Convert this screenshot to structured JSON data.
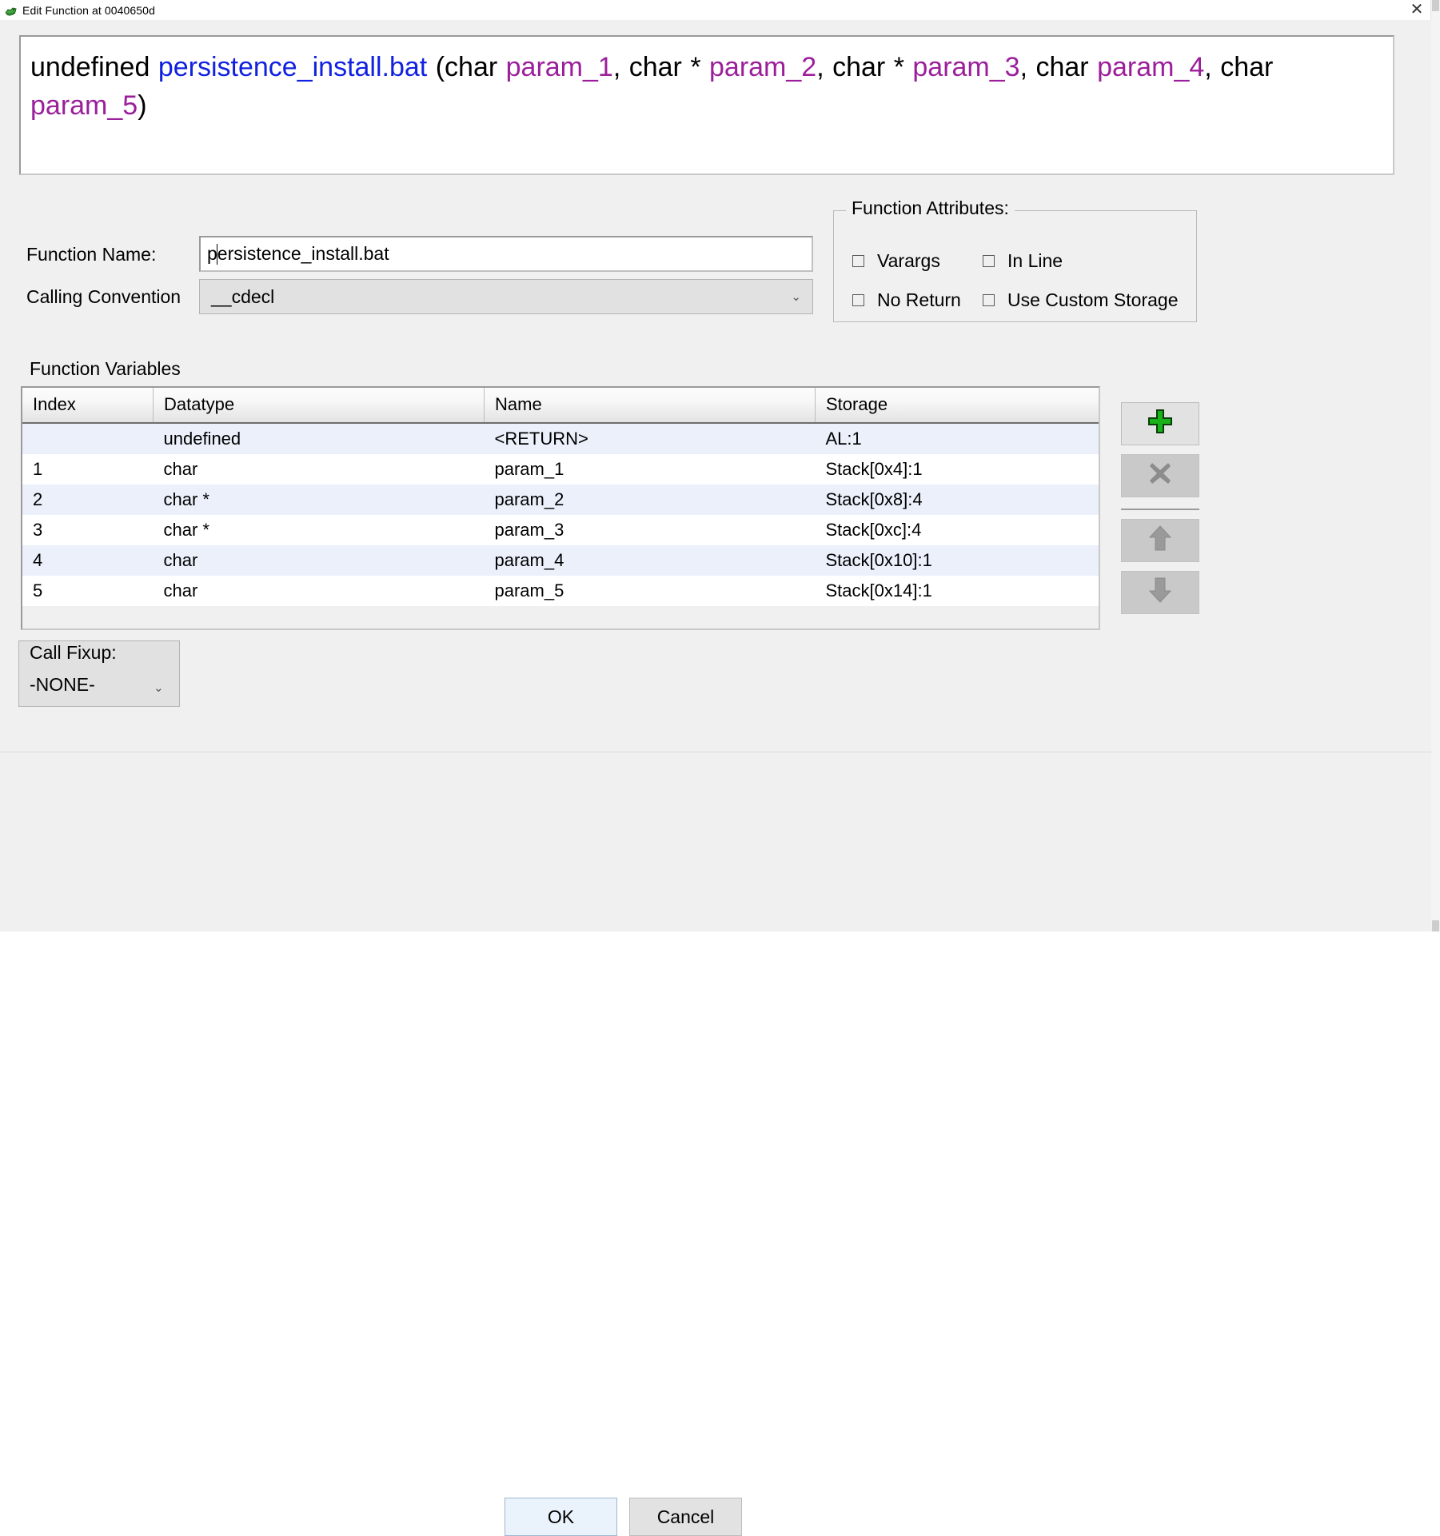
{
  "window": {
    "title": "Edit Function at 0040650d",
    "icon": "ghidra-dragon-icon",
    "close_label": "✕"
  },
  "signature": {
    "return_type": "undefined",
    "function_name": "persistence_install.bat",
    "open_paren": " (",
    "close_paren": ")",
    "parts": [
      {
        "type": "char ",
        "name": "param_1",
        "sep": ", "
      },
      {
        "type": "char * ",
        "name": "param_2",
        "sep": ", "
      },
      {
        "type": "char * ",
        "name": "param_3",
        "sep": ", "
      },
      {
        "type": "char ",
        "name": "param_4",
        "sep": ", "
      },
      {
        "type": "char ",
        "name": "param_5",
        "sep": ""
      }
    ],
    "full_text": "undefined persistence_install.bat (char param_1, char * param_2, char * param_3, char param_4, char param_5)",
    "colors": {
      "function_name": "#1021e0",
      "parameter": "#9b1f9b",
      "text": "#000000"
    }
  },
  "form": {
    "function_name_label": "Function Name:",
    "function_name_value": "persistence_install.bat",
    "function_name_caret_after": "p",
    "calling_convention_label": "Calling Convention",
    "calling_convention_value": "__cdecl",
    "chevron": "⌄"
  },
  "function_attributes": {
    "legend": "Function Attributes:",
    "items": [
      {
        "label": "Varargs",
        "checked": false
      },
      {
        "label": "In Line",
        "checked": false
      },
      {
        "label": "No Return",
        "checked": false
      },
      {
        "label": "Use Custom Storage",
        "checked": false
      }
    ]
  },
  "function_variables": {
    "title": "Function Variables",
    "columns": [
      "Index",
      "Datatype",
      "Name",
      "Storage"
    ],
    "rows": [
      {
        "index": "",
        "datatype": "undefined",
        "name": "<RETURN>",
        "storage": "AL:1",
        "name_muted": true
      },
      {
        "index": "1",
        "datatype": "char",
        "name": "param_1",
        "storage": "Stack[0x4]:1",
        "name_muted": false
      },
      {
        "index": "2",
        "datatype": "char *",
        "name": "param_2",
        "storage": "Stack[0x8]:4",
        "name_muted": false
      },
      {
        "index": "3",
        "datatype": "char *",
        "name": "param_3",
        "storage": "Stack[0xc]:4",
        "name_muted": false
      },
      {
        "index": "4",
        "datatype": "char",
        "name": "param_4",
        "storage": "Stack[0x10]:1",
        "name_muted": false
      },
      {
        "index": "5",
        "datatype": "char",
        "name": "param_5",
        "storage": "Stack[0x14]:1",
        "name_muted": false
      }
    ]
  },
  "side_buttons": [
    {
      "name": "add-variable-button",
      "icon": "plus-icon",
      "enabled": true
    },
    {
      "name": "delete-variable-button",
      "icon": "close-x-icon",
      "enabled": false
    },
    {
      "name": "move-up-button",
      "icon": "arrow-up-icon",
      "enabled": false
    },
    {
      "name": "move-down-button",
      "icon": "arrow-down-icon",
      "enabled": false
    }
  ],
  "call_fixup": {
    "label": "Call Fixup:",
    "value": "-NONE-",
    "chevron": "⌄"
  },
  "footer": {
    "ok_label": "OK",
    "cancel_label": "Cancel"
  }
}
